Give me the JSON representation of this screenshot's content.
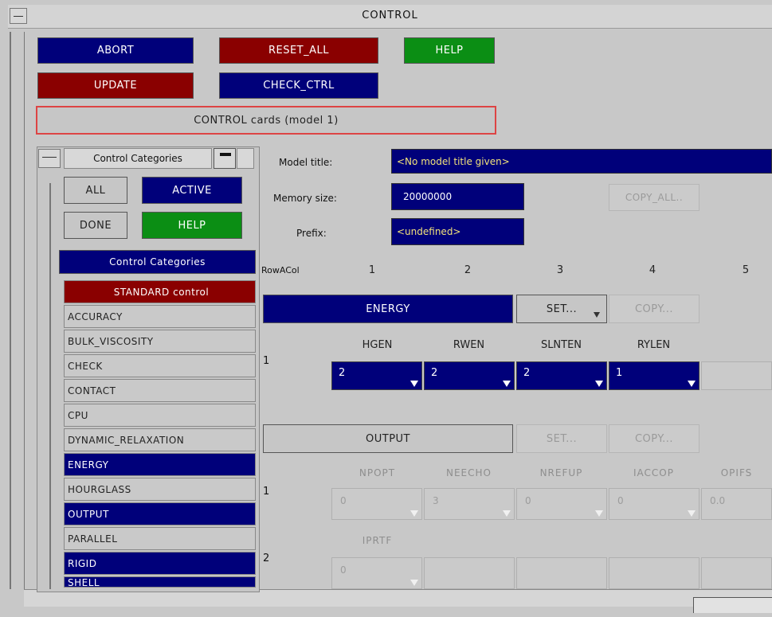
{
  "window": {
    "title": "CONTROL"
  },
  "top_buttons": {
    "abort": "ABORT",
    "reset_all": "RESET_ALL",
    "help": "HELP",
    "update": "UPDATE",
    "check_ctrl": "CHECK_CTRL",
    "control_cards": "CONTROL cards (model 1)"
  },
  "categories_panel": {
    "title": "Control Categories",
    "all": "ALL",
    "active": "ACTIVE",
    "done": "DONE",
    "help": "HELP",
    "list_header": "Control Categories",
    "items": [
      "STANDARD control",
      "ACCURACY",
      "BULK_VISCOSITY",
      "CHECK",
      "CONTACT",
      "CPU",
      "DYNAMIC_RELAXATION",
      "ENERGY",
      "HOURGLASS",
      "OUTPUT",
      "PARALLEL",
      "RIGID",
      "SHELL"
    ]
  },
  "model": {
    "title_label": "Model title:",
    "title_value": "<No model title given>",
    "memory_label": "Memory size:",
    "memory_value": "20000000",
    "prefix_label": "Prefix:",
    "prefix_value": "<undefined>",
    "copy_all": "COPY_ALL.."
  },
  "grid": {
    "rowcol_label": "RowACol",
    "columns": [
      "1",
      "2",
      "3",
      "4",
      "5"
    ]
  },
  "energy": {
    "name": "ENERGY",
    "set": "SET...",
    "copy": "COPY...",
    "row_label": "1",
    "headers": [
      "HGEN",
      "RWEN",
      "SLNTEN",
      "RYLEN"
    ],
    "values": [
      "2",
      "2",
      "2",
      "1"
    ]
  },
  "output": {
    "name": "OUTPUT",
    "set": "SET...",
    "copy": "COPY...",
    "row1_label": "1",
    "row1_headers": [
      "NPOPT",
      "NEECHO",
      "NREFUP",
      "IACCOP",
      "OPIFS"
    ],
    "row1_values": [
      "0",
      "3",
      "0",
      "0",
      "0.0"
    ],
    "row2_label": "2",
    "row2_headers": [
      "IPRTF"
    ],
    "row2_values": [
      "0"
    ]
  }
}
